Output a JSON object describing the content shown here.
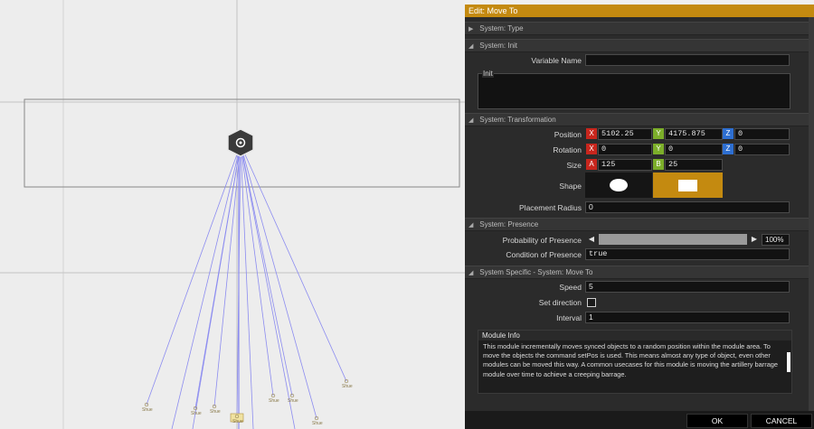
{
  "dialog": {
    "title": "Edit: Move To",
    "ok_label": "OK",
    "cancel_label": "CANCEL"
  },
  "sections": {
    "type": "System: Type",
    "init": "System: Init",
    "transformation": "System: Transformation",
    "presence": "System: Presence",
    "specific": "System Specific - System: Move To"
  },
  "init": {
    "variable_name_label": "Variable Name",
    "variable_name_value": "",
    "init_label": "Init",
    "init_value": ""
  },
  "transformation": {
    "position_label": "Position",
    "position": {
      "x": "5102.25",
      "y": "4175.875",
      "z": "0"
    },
    "rotation_label": "Rotation",
    "rotation": {
      "x": "0",
      "y": "0",
      "z": "0"
    },
    "size_label": "Size",
    "size": {
      "a": "125",
      "b": "25"
    },
    "shape_label": "Shape",
    "shape_selected": "rectangle",
    "placement_radius_label": "Placement Radius",
    "placement_radius": "0"
  },
  "axes": {
    "x": "X",
    "y": "Y",
    "z": "Z",
    "a": "A",
    "b": "B"
  },
  "presence": {
    "probability_label": "Probability of Presence",
    "probability_value": "100%",
    "probability_fraction": 1.0,
    "condition_label": "Condition of Presence",
    "condition_value": "true"
  },
  "specific": {
    "speed_label": "Speed",
    "speed_value": "5",
    "set_direction_label": "Set direction",
    "set_direction_checked": false,
    "interval_label": "Interval",
    "interval_value": "1"
  },
  "module_info": {
    "title": "Module Info",
    "text": "This module incrementally moves synced objects to a random position within the module area. To move the objects the command setPos is used. This means almost any type of object, even other modules can be moved this way. A common usecases for this module is moving the artillery barrage module over time to achieve a creeping barrage."
  },
  "canvas": {
    "unit_label": "Shue",
    "link_color": "#8c8cf0",
    "accent_color": "#c48a10"
  }
}
